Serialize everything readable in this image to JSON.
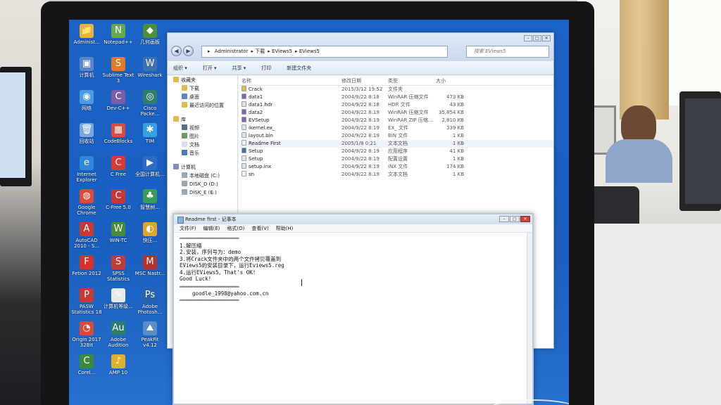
{
  "desktop": {
    "icons": [
      {
        "label": "Administ...",
        "glyph": "📁",
        "color": "#e8b33b"
      },
      {
        "label": "Notepad++",
        "glyph": "N",
        "color": "#6aa84f"
      },
      {
        "label": "几何画板",
        "glyph": "◆",
        "color": "#4c8f3a"
      },
      {
        "label": "计算机",
        "glyph": "▣",
        "color": "#5b86c5"
      },
      {
        "label": "Sublime Text 3",
        "glyph": "S",
        "color": "#e07b28"
      },
      {
        "label": "Wireshark",
        "glyph": "W",
        "color": "#3f6fb2"
      },
      {
        "label": "网络",
        "glyph": "◉",
        "color": "#4b9be0"
      },
      {
        "label": "Dev-C++",
        "glyph": "C",
        "color": "#7b5ea7"
      },
      {
        "label": "Cisco Packe...",
        "glyph": "◎",
        "color": "#2f7d6a"
      },
      {
        "label": "回收站",
        "glyph": "🗑",
        "color": "#7ba7d8"
      },
      {
        "label": "CodeBlocks",
        "glyph": "▦",
        "color": "#d94c3d"
      },
      {
        "label": "TIM",
        "glyph": "✱",
        "color": "#39a0e0"
      },
      {
        "label": "Internet Explorer",
        "glyph": "e",
        "color": "#2e86de"
      },
      {
        "label": "C Free",
        "glyph": "C",
        "color": "#d83a3a"
      },
      {
        "label": "全国计算机...",
        "glyph": "▶",
        "color": "#2d6cc0"
      },
      {
        "label": "Google Chrome",
        "glyph": "◍",
        "color": "#e04a35"
      },
      {
        "label": "C-Free 5.0",
        "glyph": "C",
        "color": "#c93636"
      },
      {
        "label": "智慧树...",
        "glyph": "♣",
        "color": "#3b9c5a"
      },
      {
        "label": "AutoCAD 2010 - S...",
        "glyph": "A",
        "color": "#c73a2f"
      },
      {
        "label": "WIN-TC",
        "glyph": "W",
        "color": "#4a8a3b"
      },
      {
        "label": "快压...",
        "glyph": "◐",
        "color": "#e3a328"
      },
      {
        "label": "Fetion 2012",
        "glyph": "F",
        "color": "#d4322a"
      },
      {
        "label": "SPSS Statistics",
        "glyph": "S",
        "color": "#c23b36"
      },
      {
        "label": "MSC Nastr...",
        "glyph": "M",
        "color": "#b6312a"
      },
      {
        "label": "PASW Statistics 18",
        "glyph": "P",
        "color": "#c83a31"
      },
      {
        "label": "计算机等级...",
        "glyph": "✎",
        "color": "#e9e9e9"
      },
      {
        "label": "Adobe Photosh...",
        "glyph": "Ps",
        "color": "#2b5fa8"
      },
      {
        "label": "Origin 2017 32Bit",
        "glyph": "◔",
        "color": "#d64a3a"
      },
      {
        "label": "Adobe Audition",
        "glyph": "Au",
        "color": "#2d7c6e"
      },
      {
        "label": "PeakFit v4.12",
        "glyph": "⛰",
        "color": "#5b8cc5"
      },
      {
        "label": "Corel...",
        "glyph": "C",
        "color": "#3a8a3a"
      },
      {
        "label": "AMP 10",
        "glyph": "♪",
        "color": "#e0b02a"
      }
    ]
  },
  "explorer": {
    "breadcrumb": [
      "Administrator",
      "下载",
      "EViews5",
      "EViews5"
    ],
    "search_placeholder": "搜索 EViews5",
    "toolbar": [
      "组织 ▾",
      "打开 ▾",
      "共享 ▾",
      "打印",
      "新建文件夹"
    ],
    "nav": {
      "favorites": "收藏夹",
      "downloads": "下载",
      "desktop": "桌面",
      "recent": "最近访问的位置",
      "libraries": "库",
      "videos": "视频",
      "pictures": "图片",
      "documents": "文档",
      "music": "音乐",
      "computer": "计算机",
      "local_disk_c": "本地磁盘 (C:)",
      "disk_d": "DISK_D (D:)",
      "disk_e": "DISK_E (E:)"
    },
    "columns": {
      "name": "名称",
      "date": "修改日期",
      "type": "类型",
      "size": "大小"
    },
    "files": [
      {
        "name": "Crack",
        "date": "2015/3/12 19:52",
        "type": "文件夹",
        "size": "",
        "color": "#e3b84a"
      },
      {
        "name": "data1",
        "date": "2004/9/22 8:18",
        "type": "WinRAR 压缩文件",
        "size": "473 KB",
        "color": "#8a63b0"
      },
      {
        "name": "data1.hdr",
        "date": "2004/9/22 8:18",
        "type": "HDR 文件",
        "size": "43 KB",
        "color": "#dfe3ea"
      },
      {
        "name": "data2",
        "date": "2004/9/22 8:19",
        "type": "WinRAR 压缩文件",
        "size": "35,854 KB",
        "color": "#8a63b0"
      },
      {
        "name": "EVSetup",
        "date": "2004/9/22 8:19",
        "type": "WinRAR ZIP 压缩...",
        "size": "2,810 KB",
        "color": "#8a63b0"
      },
      {
        "name": "ikernel.ex_",
        "date": "2004/9/22 8:19",
        "type": "EX_ 文件",
        "size": "339 KB",
        "color": "#dfe3ea"
      },
      {
        "name": "layout.bin",
        "date": "2004/9/22 8:19",
        "type": "BIN 文件",
        "size": "1 KB",
        "color": "#dfe3ea"
      },
      {
        "name": "Readme First",
        "date": "2005/1/8 0:21",
        "type": "文本文档",
        "size": "1 KB",
        "color": "#f0f0f0"
      },
      {
        "name": "Setup",
        "date": "2004/9/22 8:19",
        "type": "应用程序",
        "size": "41 KB",
        "color": "#3a6fb5"
      },
      {
        "name": "Setup",
        "date": "2004/9/22 8:19",
        "type": "配置设置",
        "size": "1 KB",
        "color": "#dfe3ea"
      },
      {
        "name": "setup.inx",
        "date": "2004/9/22 8:19",
        "type": "INX 文件",
        "size": "174 KB",
        "color": "#dfe3ea"
      },
      {
        "name": "sn",
        "date": "2004/9/22 8:19",
        "type": "文本文档",
        "size": "1 KB",
        "color": "#f0f0f0"
      }
    ]
  },
  "notepad": {
    "title": "Readme first - 记事本",
    "menu": [
      "文件(F)",
      "编辑(E)",
      "格式(O)",
      "查看(V)",
      "帮助(H)"
    ],
    "rule": "══════════════════════════",
    "lines": [
      "1.解压缩",
      "2.安装，序列号为：demo",
      "3.将Crack文件夹中的两个文件拷贝覆盖到",
      "EViews5的安装目录下，运行Eviews5.reg",
      "4.运行EViews5。That's OK!",
      "Good Luck!"
    ],
    "email": "goodle_1998@yahoo.com.cn"
  }
}
